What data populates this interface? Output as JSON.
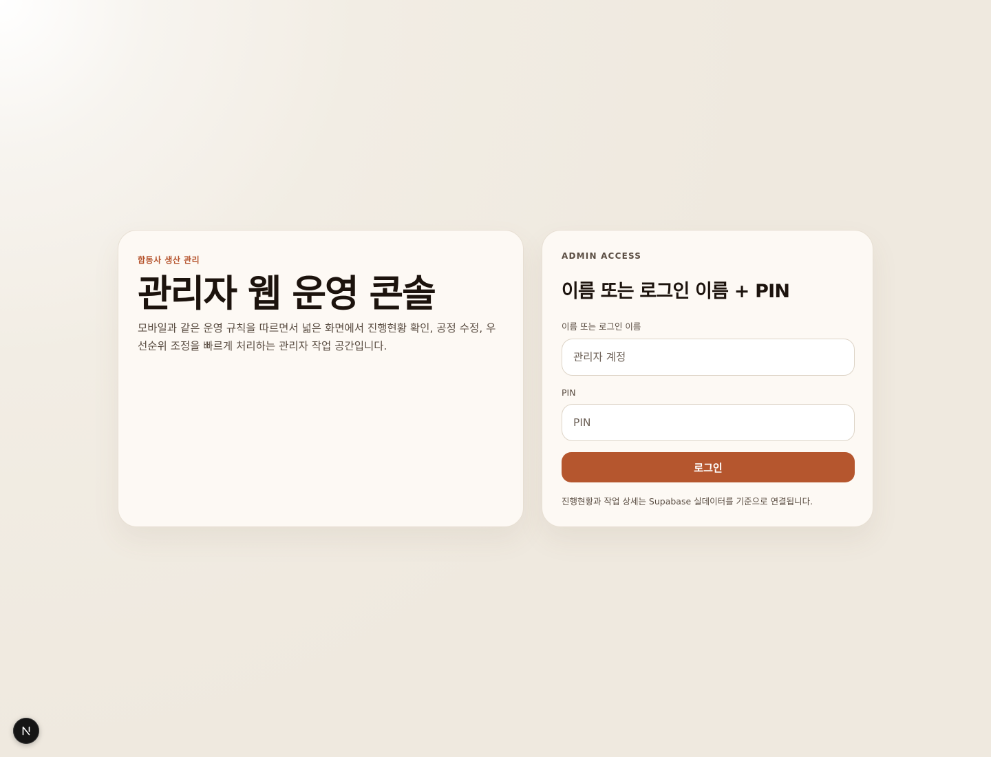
{
  "intro": {
    "eyebrow": "합동사 생산 관리",
    "title": "관리자 웹 운영 콘솔",
    "description": "모바일과 같은 운영 규칙을 따르면서 넓은 화면에서 진행현황 확인, 공정 수정, 우선순위 조정을 빠르게 처리하는 관리자 작업 공간입니다."
  },
  "login": {
    "eyebrow": "ADMIN ACCESS",
    "title": "이름 또는 로그인 이름 + PIN",
    "username": {
      "label": "이름 또는 로그인 이름",
      "placeholder": "관리자 계정",
      "value": ""
    },
    "pin": {
      "label": "PIN",
      "placeholder": "PIN",
      "value": ""
    },
    "submit_label": "로그인",
    "footnote": "진행현황과 작업 상세는 Supabase 실데이터를 기준으로 연결됩니다."
  },
  "dev_badge": {
    "icon": "nextjs-logo-icon"
  },
  "colors": {
    "accent": "#b5562e",
    "card_background": "#fdf9f4",
    "page_background": "#f2ede4",
    "title_text": "#1c130d",
    "body_text": "#5a4d42"
  }
}
